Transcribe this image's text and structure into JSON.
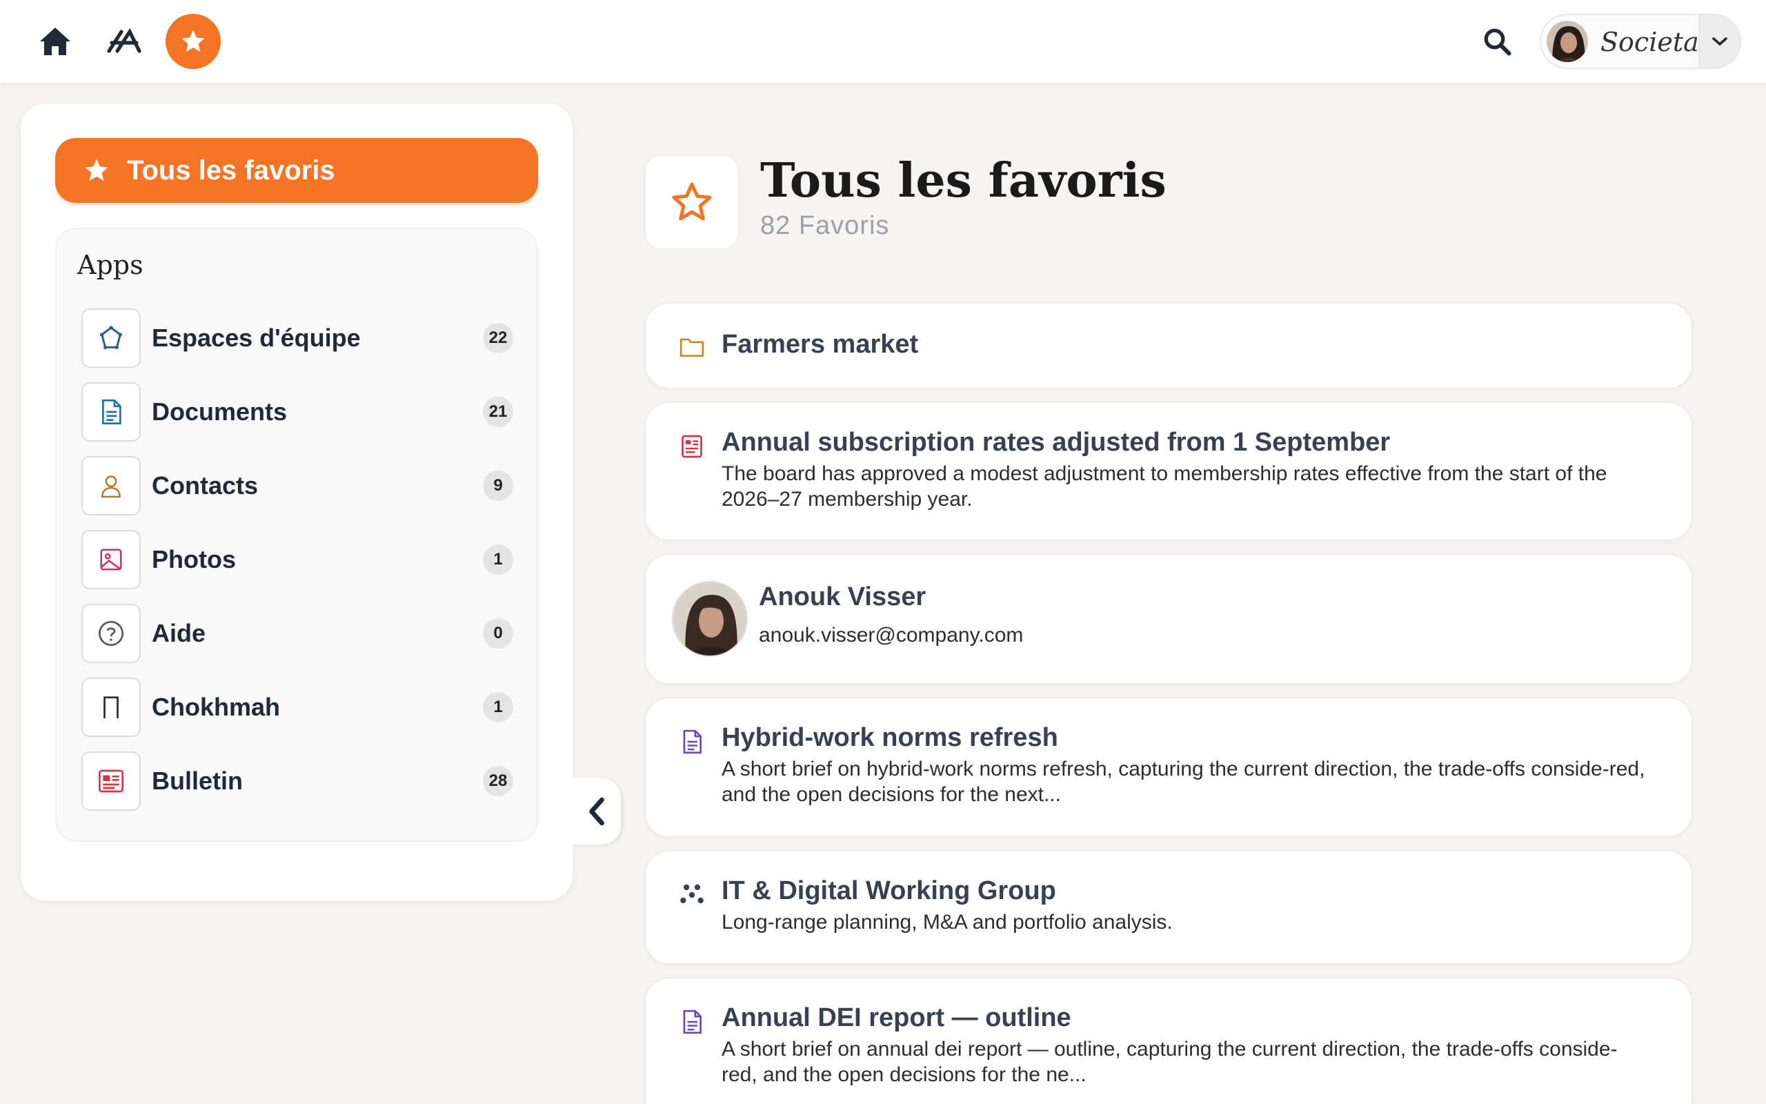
{
  "topbar": {
    "icons": [
      "home-icon",
      "apps-icon",
      "star-icon",
      "search-icon",
      "chevron-down-icon"
    ],
    "brand": "Societas"
  },
  "sidebar": {
    "all_favorites_label": "Tous les favoris",
    "apps_title": "Apps",
    "items": [
      {
        "label": "Espaces d'équipe",
        "count": "22",
        "icon": "team-spaces-icon",
        "color": "#2f5f8a"
      },
      {
        "label": "Documents",
        "count": "21",
        "icon": "document-icon",
        "color": "#1f6fa8"
      },
      {
        "label": "Contacts",
        "count": "9",
        "icon": "contact-icon",
        "color": "#b9772f"
      },
      {
        "label": "Photos",
        "count": "1",
        "icon": "photo-icon",
        "color": "#c2346b"
      },
      {
        "label": "Aide",
        "count": "0",
        "icon": "help-icon",
        "color": "#555555"
      },
      {
        "label": "Chokhmah",
        "count": "1",
        "icon": "bookmark-icon",
        "color": "#333333"
      },
      {
        "label": "Bulletin",
        "count": "28",
        "icon": "bulletin-icon",
        "color": "#d23449"
      }
    ]
  },
  "header": {
    "title": "Tous les favoris",
    "subtitle": "82 Favoris"
  },
  "favorites": [
    {
      "type": "folder",
      "icon": "folder-icon",
      "title": "Farmers market",
      "desc": ""
    },
    {
      "type": "bulletin",
      "icon": "bulletin-icon",
      "title": "Annual subscription rates adjusted from 1 September",
      "desc": "The board has approved a modest adjustment to membership rates effective from the start of the 2026–27 membership year."
    },
    {
      "type": "contact",
      "icon": "avatar",
      "title": "Anouk Visser",
      "desc": "anouk.visser@company.com"
    },
    {
      "type": "document",
      "icon": "document-icon",
      "title": "Hybrid-work norms refresh",
      "desc": "A short brief on hybrid-work norms refresh, capturing the current direction, the trade-offs conside-red, and the open decisions for the next..."
    },
    {
      "type": "group",
      "icon": "group-icon",
      "title": "IT & Digital Working Group",
      "desc": "Long-range planning, M&A and portfolio analysis."
    },
    {
      "type": "document",
      "icon": "document-icon",
      "title": "Annual DEI report — outline",
      "desc": "A short brief on annual dei report — outline, capturing the current direction, the trade-offs conside-red, and the open decisions for the ne..."
    }
  ],
  "colors": {
    "accent": "#f47325",
    "background": "#f6f4f1"
  }
}
